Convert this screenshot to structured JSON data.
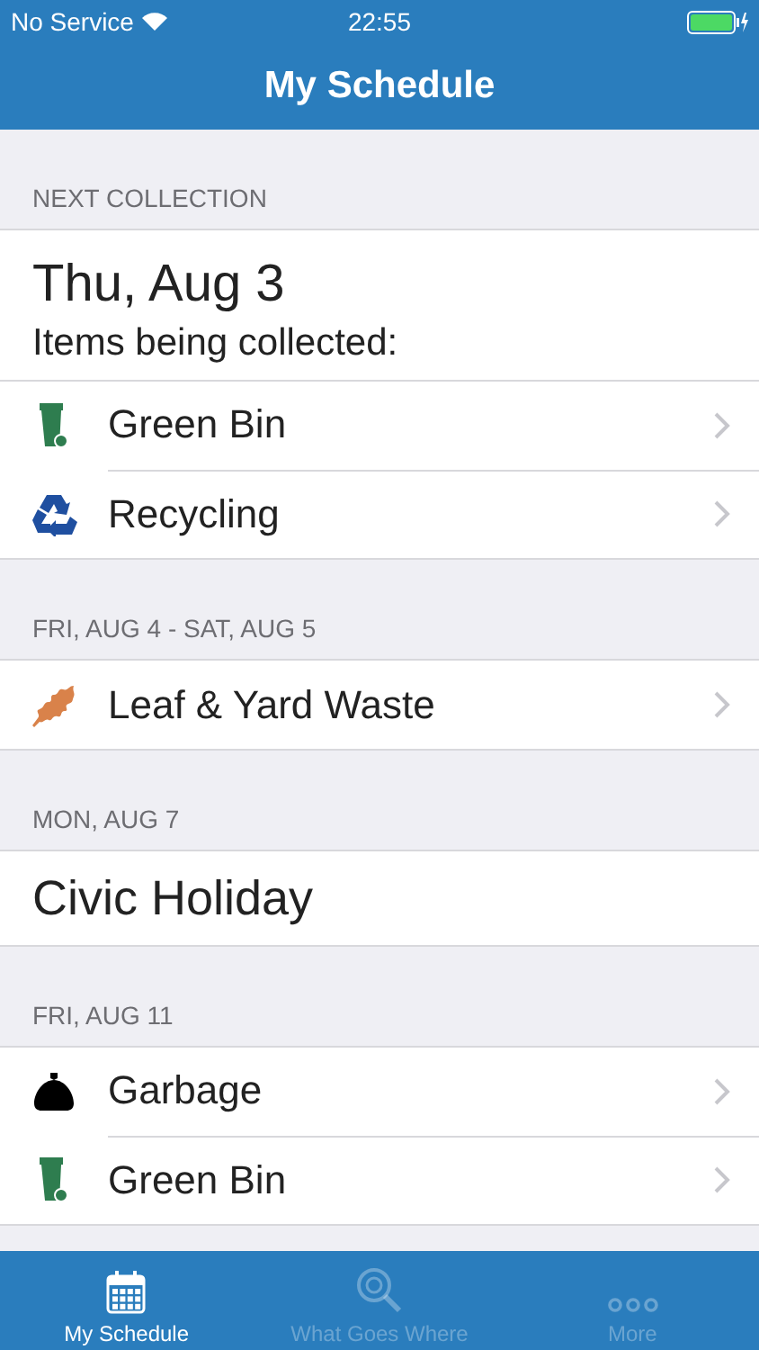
{
  "status_bar": {
    "carrier": "No Service",
    "time": "22:55"
  },
  "nav": {
    "title": "My Schedule"
  },
  "sections": [
    {
      "header": "NEXT COLLECTION",
      "date": "Thu, Aug 3",
      "subtitle": "Items being collected:",
      "items": [
        {
          "label": "Green Bin",
          "kind": "bin"
        },
        {
          "label": "Recycling",
          "kind": "recycling"
        }
      ]
    },
    {
      "header": "FRI, AUG 4 - SAT, AUG 5",
      "items": [
        {
          "label": "Leaf & Yard Waste",
          "kind": "leaf"
        }
      ]
    },
    {
      "header": "MON, AUG 7",
      "note": "Civic Holiday"
    },
    {
      "header": "FRI, AUG 11",
      "items": [
        {
          "label": "Garbage",
          "kind": "garbage"
        },
        {
          "label": "Green Bin",
          "kind": "bin"
        }
      ]
    }
  ],
  "tabs": [
    {
      "label": "My Schedule",
      "kind": "calendar",
      "selected": true
    },
    {
      "label": "What Goes Where",
      "kind": "search",
      "selected": false
    },
    {
      "label": "More",
      "kind": "more",
      "selected": false
    }
  ]
}
